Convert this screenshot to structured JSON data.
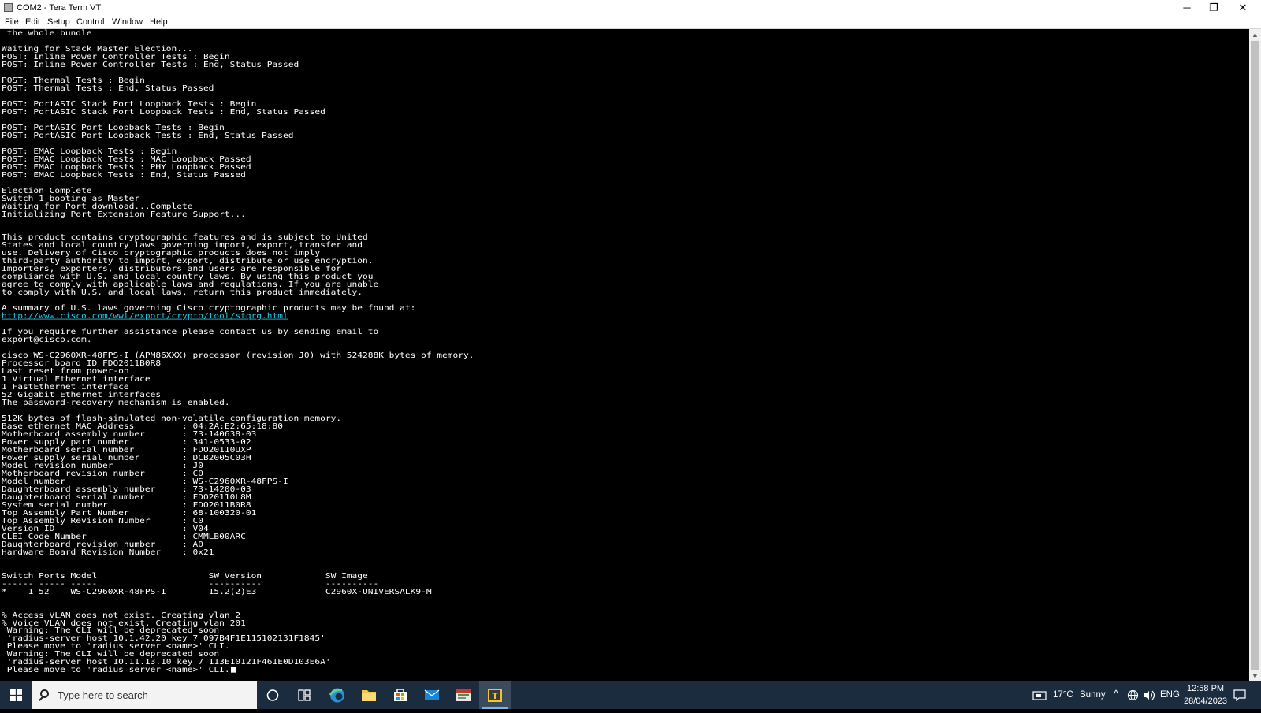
{
  "window": {
    "title": "COM2 - Tera Term VT",
    "minimize": "─",
    "restore": "❐",
    "close": "✕"
  },
  "menu": [
    "File",
    "Edit",
    "Setup",
    "Control",
    "Window",
    "Help"
  ],
  "terminal": {
    "lines": [
      " the whole bundle",
      "",
      "Waiting for Stack Master Election...",
      "POST: Inline Power Controller Tests : Begin",
      "POST: Inline Power Controller Tests : End, Status Passed",
      "",
      "POST: Thermal Tests : Begin",
      "POST: Thermal Tests : End, Status Passed",
      "",
      "POST: PortASIC Stack Port Loopback Tests : Begin",
      "POST: PortASIC Stack Port Loopback Tests : End, Status Passed",
      "",
      "POST: PortASIC Port Loopback Tests : Begin",
      "POST: PortASIC Port Loopback Tests : End, Status Passed",
      "",
      "POST: EMAC Loopback Tests : Begin",
      "POST: EMAC Loopback Tests : MAC Loopback Passed",
      "POST: EMAC Loopback Tests : PHY Loopback Passed",
      "POST: EMAC Loopback Tests : End, Status Passed",
      "",
      "Election Complete",
      "Switch 1 booting as Master",
      "Waiting for Port download...Complete",
      "Initializing Port Extension Feature Support...",
      "",
      "",
      "This product contains cryptographic features and is subject to United",
      "States and local country laws governing import, export, transfer and",
      "use. Delivery of Cisco cryptographic products does not imply",
      "third-party authority to import, export, distribute or use encryption.",
      "Importers, exporters, distributors and users are responsible for",
      "compliance with U.S. and local country laws. By using this product you",
      "agree to comply with applicable laws and regulations. If you are unable",
      "to comply with U.S. and local laws, return this product immediately.",
      "",
      "A summary of U.S. laws governing Cisco cryptographic products may be found at:",
      "http://www.cisco.com/wwl/export/crypto/tool/stqrg.html",
      "",
      "If you require further assistance please contact us by sending email to",
      "export@cisco.com.",
      "",
      "cisco WS-C2960XR-48FPS-I (APM86XXX) processor (revision J0) with 524288K bytes of memory.",
      "Processor board ID FDO2011B0R8",
      "Last reset from power-on",
      "1 Virtual Ethernet interface",
      "1 FastEthernet interface",
      "52 Gigabit Ethernet interfaces",
      "The password-recovery mechanism is enabled.",
      "",
      "512K bytes of flash-simulated non-volatile configuration memory.",
      "Base ethernet MAC Address         : 04:2A:E2:65:18:80",
      "Motherboard assembly number       : 73-140638-03",
      "Power supply part number          : 341-0533-02",
      "Motherboard serial number         : FDO20110UXP",
      "Power supply serial number        : DCB2005C03H",
      "Model revision number             : J0",
      "Motherboard revision number       : C0",
      "Model number                      : WS-C2960XR-48FPS-I",
      "Daughterboard assembly number     : 73-14200-03",
      "Daughterboard serial number       : FDO20110L8M",
      "System serial number              : FDO2011B0R8",
      "Top Assembly Part Number          : 68-100320-01",
      "Top Assembly Revision Number      : C0",
      "Version ID                        : V04",
      "CLEI Code Number                  : CMMLB00ARC",
      "Daughterboard revision number     : A0",
      "Hardware Board Revision Number    : 0x21",
      "",
      "",
      "Switch Ports Model                     SW Version            SW Image",
      "------ ----- -----                     ----------            ----------",
      "*    1 52    WS-C2960XR-48FPS-I        15.2(2)E3             C2960X-UNIVERSALK9-M",
      "",
      "",
      "% Access VLAN does not exist. Creating vlan 2",
      "% Voice VLAN does not exist. Creating vlan 201",
      " Warning: The CLI will be deprecated soon",
      " 'radius-server host 10.1.42.20 key 7 097B4F1E115102131F1845'",
      " Please move to 'radius server <name>' CLI.",
      " Warning: The CLI will be deprecated soon",
      " 'radius-server host 10.11.13.10 key 7 113E10121F461E0D103E6A'",
      " Please move to 'radius server <name>' CLI."
    ],
    "link_line_index": 36,
    "text_color": "#ffffff",
    "link_color": "#23c7ea",
    "background": "#000000"
  },
  "taskbar": {
    "search_placeholder": "Type here to search",
    "apps": [
      {
        "name": "cortana-icon"
      },
      {
        "name": "task-view-icon"
      },
      {
        "name": "edge-icon"
      },
      {
        "name": "file-explorer-icon"
      },
      {
        "name": "microsoft-store-icon"
      },
      {
        "name": "mail-icon"
      },
      {
        "name": "app-icon"
      },
      {
        "name": "tera-term-icon",
        "active": true
      }
    ],
    "weather": {
      "temp": "17°C",
      "condition": "Sunny"
    },
    "tray_chevron": "^",
    "language": "ENG",
    "time": "12:58 PM",
    "date": "28/04/2023"
  }
}
